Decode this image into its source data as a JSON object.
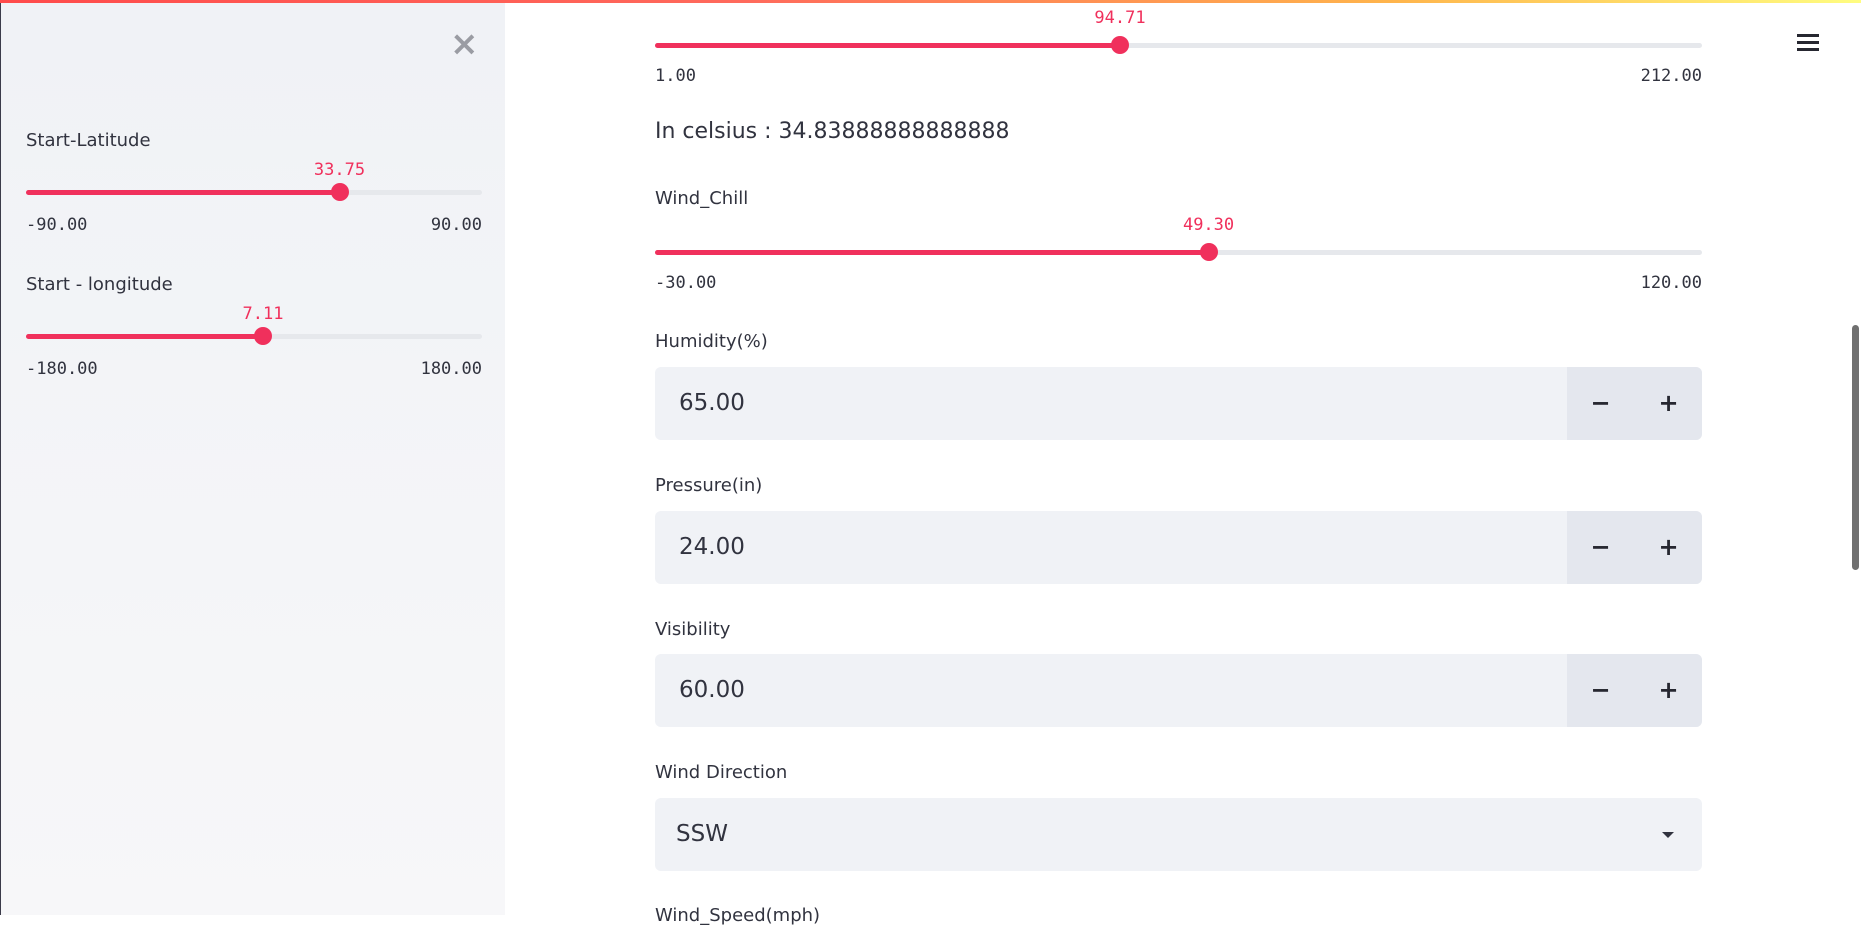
{
  "sidebar": {
    "sliders": [
      {
        "label": "Start-Latitude",
        "value": "33.75",
        "min": "-90.00",
        "max": "90.00",
        "fraction": 0.6875
      },
      {
        "label": "Start - longitude",
        "value": "7.11",
        "min": "-180.00",
        "max": "180.00",
        "fraction": 0.5198
      }
    ]
  },
  "main": {
    "temperature_slider": {
      "value": "94.71",
      "min": "1.00",
      "max": "212.00",
      "fraction": 0.4441
    },
    "celsius_text": "In celsius : 34.83888888888888",
    "wind_chill": {
      "label": "Wind_Chill",
      "value": "49.30",
      "min": "-30.00",
      "max": "120.00",
      "fraction": 0.5287
    },
    "humidity": {
      "label": "Humidity(%)",
      "value": "65.00"
    },
    "pressure": {
      "label": "Pressure(in)",
      "value": "24.00"
    },
    "visibility": {
      "label": "Visibility",
      "value": "60.00"
    },
    "wind_direction": {
      "label": "Wind Direction",
      "value": "SSW"
    },
    "wind_speed": {
      "label": "Wind_Speed(mph)"
    },
    "stepper": {
      "minus": "−",
      "plus": "+"
    }
  },
  "icons": {
    "close": "close-icon",
    "menu": "hamburger-menu-icon"
  },
  "colors": {
    "accent": "#f0305c",
    "input_bg": "#f0f2f6"
  }
}
